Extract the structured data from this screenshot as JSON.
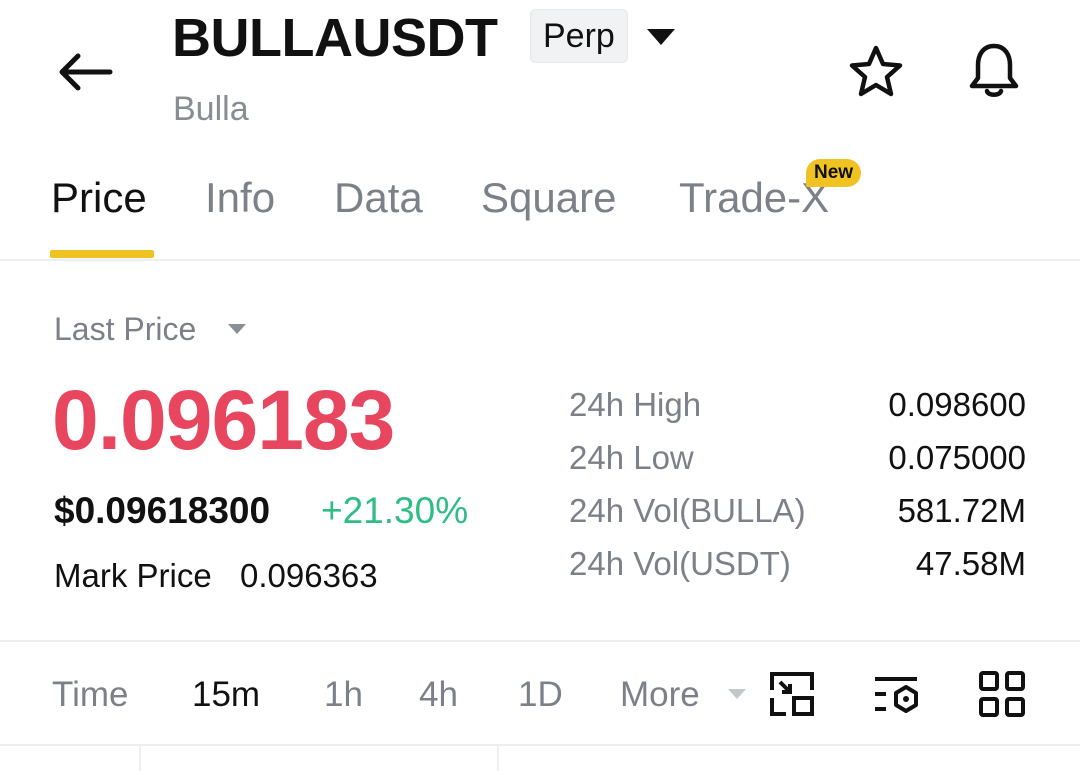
{
  "header": {
    "symbol": "BULLAUSDT",
    "contract_type": "Perp",
    "subtitle": "Bulla",
    "icons": [
      "arrow-left-icon",
      "caret-down-icon",
      "star-icon",
      "bell-icon"
    ]
  },
  "tabs": [
    {
      "label": "Price",
      "active": true
    },
    {
      "label": "Info",
      "active": false
    },
    {
      "label": "Data",
      "active": false
    },
    {
      "label": "Square",
      "active": false
    },
    {
      "label": "Trade-X",
      "active": false,
      "badge": "New"
    }
  ],
  "price": {
    "last_price_label": "Last Price",
    "last_price": "0.096183",
    "usd_price": "$0.09618300",
    "change_pct": "+21.30%",
    "mark_price_label": "Mark Price",
    "mark_price": "0.096363"
  },
  "stats": [
    {
      "label": "24h High",
      "value": "0.098600"
    },
    {
      "label": "24h Low",
      "value": "0.075000"
    },
    {
      "label": "24h Vol(BULLA)",
      "value": "581.72M"
    },
    {
      "label": "24h Vol(USDT)",
      "value": "47.58M"
    }
  ],
  "intervals": {
    "time_label": "Time",
    "items": [
      "15m",
      "1h",
      "4h",
      "1D"
    ],
    "active": "15m",
    "more_label": "More",
    "tool_icons": [
      "fullscreen-toggle-icon",
      "indicator-settings-icon",
      "grid-layout-icon"
    ]
  },
  "colors": {
    "accent": "#f0c323",
    "price_down_red": "#e8465e",
    "change_green": "#2ebd85",
    "muted_text": "#7c8088"
  }
}
